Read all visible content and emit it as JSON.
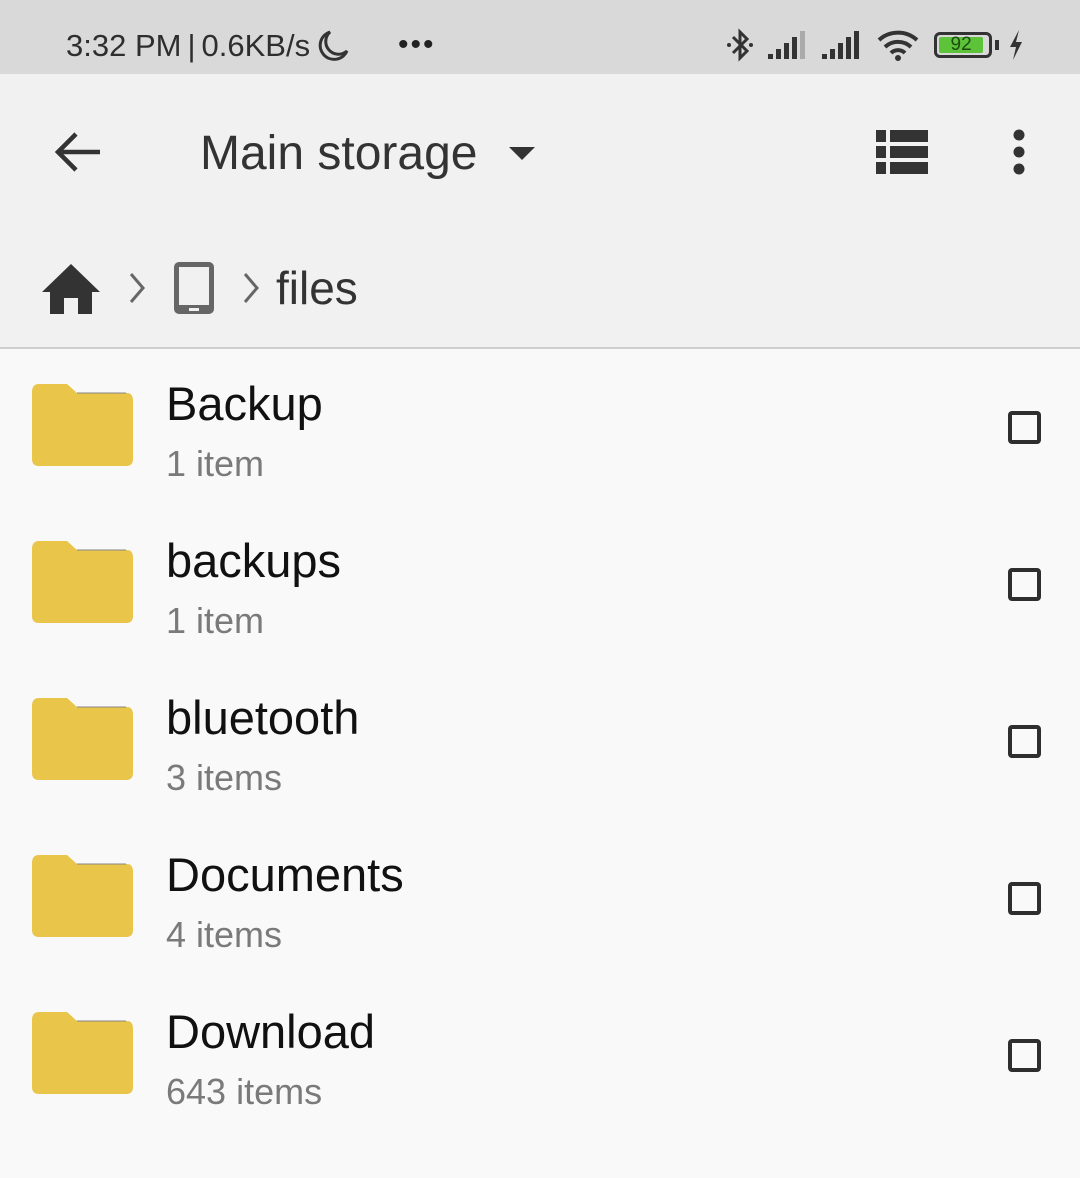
{
  "status_bar": {
    "time": "3:32 PM",
    "separator": "|",
    "net_speed": "0.6KB/s",
    "more": "•••",
    "battery_level": "92",
    "icons": [
      "moon-icon",
      "bluetooth-icon",
      "signal-icon",
      "signal-icon",
      "wifi-icon",
      "battery-icon",
      "charging-icon"
    ]
  },
  "toolbar": {
    "title": "Main storage",
    "icons": [
      "back-arrow-icon",
      "dropdown-caret-icon",
      "list-view-icon",
      "more-vert-icon"
    ]
  },
  "breadcrumb": {
    "items": [
      "home",
      "device",
      "files"
    ],
    "current": "files"
  },
  "files": [
    {
      "name": "Backup",
      "count": "1 item"
    },
    {
      "name": "backups",
      "count": "1 item"
    },
    {
      "name": "bluetooth",
      "count": "3 items"
    },
    {
      "name": "Documents",
      "count": "4 items"
    },
    {
      "name": "Download",
      "count": "643 items"
    }
  ],
  "colors": {
    "folder": "#e9c54a",
    "battery": "#5dc43a"
  }
}
